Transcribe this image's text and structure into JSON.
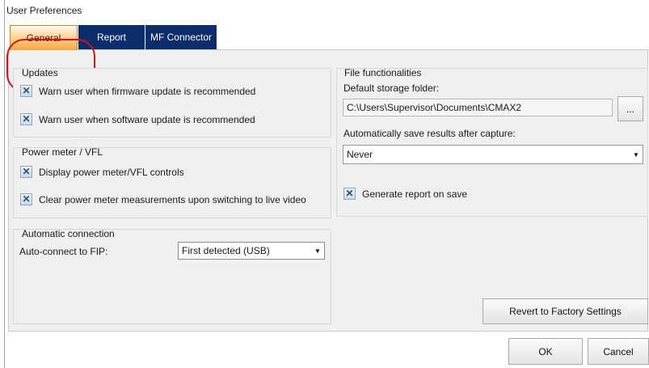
{
  "window": {
    "title": "User Preferences"
  },
  "tabs": [
    {
      "label": "General",
      "active": true
    },
    {
      "label": "Report",
      "active": false
    },
    {
      "label": "MF Connector",
      "active": false
    }
  ],
  "updates": {
    "title": "Updates",
    "firmware_label": "Warn user when firmware update is recommended",
    "software_label": "Warn user when software update is recommended",
    "firmware_checked": true,
    "software_checked": true
  },
  "power_meter": {
    "title": "Power meter / VFL",
    "display_label": "Display power meter/VFL controls",
    "clear_label": "Clear power meter measurements upon switching to live video",
    "display_checked": true,
    "clear_checked": true
  },
  "auto_connection": {
    "title": "Automatic connection",
    "label": "Auto-connect to FIP:",
    "selected": "First detected (USB)"
  },
  "file_functionalities": {
    "title": "File functionalities",
    "storage_label": "Default storage folder:",
    "storage_value": "C:\\Users\\Supervisor\\Documents\\CMAX2",
    "browse_label": "...",
    "autosave_label": "Automatically save results after capture:",
    "autosave_selected": "Never",
    "report_label": "Generate report on save",
    "report_checked": true
  },
  "buttons": {
    "revert": "Revert to Factory Settings",
    "ok": "OK",
    "cancel": "Cancel"
  },
  "icons": {
    "checkbox_check": "✕",
    "dropdown_arrow": "▼"
  },
  "colors": {
    "tab_active": "#f6a83d",
    "tab_inactive": "#0b2d6b",
    "highlight": "#d2141c"
  }
}
